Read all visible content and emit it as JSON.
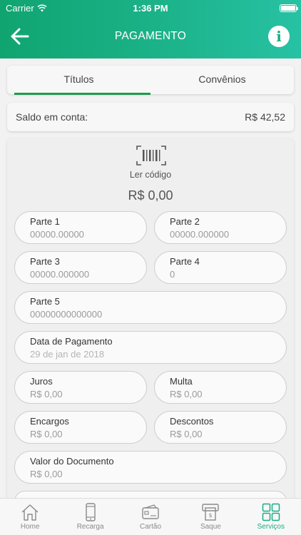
{
  "status_bar": {
    "carrier": "Carrier",
    "time": "1:36 PM"
  },
  "header": {
    "title": "PAGAMENTO",
    "back_icon": "arrow-left-icon",
    "info_icon": "info-icon"
  },
  "tabs": [
    {
      "label": "Títulos",
      "active": true
    },
    {
      "label": "Convênios",
      "active": false
    }
  ],
  "saldo": {
    "label": "Saldo em conta:",
    "value": "R$ 42,52"
  },
  "barcode": {
    "label": "Ler código",
    "amount": "R$ 0,00"
  },
  "fields": {
    "parte1": {
      "label": "Parte 1",
      "value": "00000.00000"
    },
    "parte2": {
      "label": "Parte 2",
      "value": "00000.000000"
    },
    "parte3": {
      "label": "Parte 3",
      "value": "00000.000000"
    },
    "parte4": {
      "label": "Parte 4",
      "value": "0"
    },
    "parte5": {
      "label": "Parte 5",
      "value": "00000000000000"
    },
    "data": {
      "label": "Data de Pagamento",
      "value": "29 de jan de 2018"
    },
    "juros": {
      "label": "Juros",
      "value": "R$ 0,00"
    },
    "multa": {
      "label": "Multa",
      "value": "R$ 0,00"
    },
    "encargos": {
      "label": "Encargos",
      "value": "R$ 0,00"
    },
    "descontos": {
      "label": "Descontos",
      "value": "R$ 0,00"
    },
    "valor_documento": {
      "label": "Valor do Documento",
      "value": "R$ 0,00"
    }
  },
  "tabbar": [
    {
      "label": "Home",
      "icon": "home-icon"
    },
    {
      "label": "Recarga",
      "icon": "phone-icon"
    },
    {
      "label": "Cartão",
      "icon": "card-icon"
    },
    {
      "label": "Saque",
      "icon": "atm-icon"
    },
    {
      "label": "Serviços",
      "icon": "grid-icon",
      "active": true
    }
  ],
  "colors": {
    "accent": "#1aad83",
    "tab_underline": "#1d9a4b"
  }
}
